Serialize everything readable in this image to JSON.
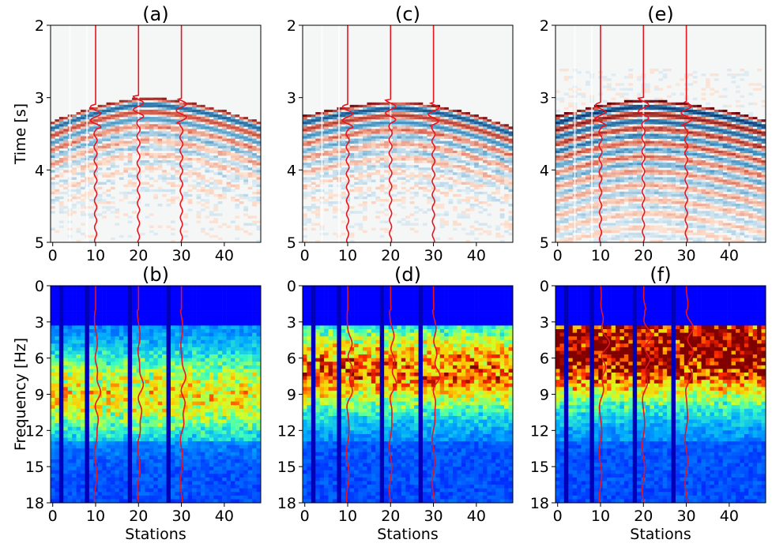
{
  "figure": {
    "ylabel_top": "Time [s]",
    "ylabel_bottom": "Frequency [Hz]",
    "xlabel": "Stations"
  },
  "colors": {
    "trace": "#e8141e",
    "seismic_negative": "#08306b",
    "seismic_positive": "#67000d",
    "background": "#f5f6f6"
  },
  "chart_data": [
    {
      "type": "heatmap",
      "title": "(a)",
      "row": "top",
      "colormap": "RdBu",
      "xlabel": "",
      "ylabel": "Time [s]",
      "xlim": [
        -0.5,
        48.5
      ],
      "ylim": [
        5,
        2
      ],
      "xticks": [
        0,
        10,
        20,
        30,
        40
      ],
      "yticks": [
        2,
        3,
        4,
        5
      ],
      "arrival_apex_station": 22,
      "arrival_apex_time": 3.05,
      "arrival_edge_time_left": 3.38,
      "arrival_edge_time_right": 3.38,
      "traces_at_stations": [
        10,
        20,
        30
      ]
    },
    {
      "type": "heatmap",
      "title": "(c)",
      "row": "top",
      "colormap": "RdBu",
      "xlabel": "",
      "ylabel": "",
      "xlim": [
        -0.5,
        48.5
      ],
      "ylim": [
        5,
        2
      ],
      "xticks": [
        0,
        10,
        20,
        30,
        40
      ],
      "yticks": [
        2,
        3,
        4,
        5
      ],
      "arrival_apex_station": 22,
      "arrival_apex_time": 3.1,
      "arrival_edge_time_left": 3.3,
      "arrival_edge_time_right": 3.45,
      "traces_at_stations": [
        10,
        20,
        30
      ]
    },
    {
      "type": "heatmap",
      "title": "(e)",
      "row": "top",
      "colormap": "RdBu",
      "xlabel": "",
      "ylabel": "",
      "xlim": [
        -0.5,
        48.5
      ],
      "ylim": [
        5,
        2
      ],
      "xticks": [
        0,
        10,
        20,
        30,
        40
      ],
      "yticks": [
        2,
        3,
        4,
        5
      ],
      "arrival_apex_station": 20,
      "arrival_apex_time": 3.08,
      "arrival_edge_time_left": 3.3,
      "arrival_edge_time_right": 3.35,
      "traces_at_stations": [
        10,
        20,
        30
      ]
    },
    {
      "type": "heatmap",
      "title": "(b)",
      "row": "bottom",
      "colormap": "jet",
      "xlabel": "Stations",
      "ylabel": "Frequency [Hz]",
      "xlim": [
        -0.5,
        48.5
      ],
      "ylim": [
        18,
        0
      ],
      "xticks": [
        0,
        10,
        20,
        30,
        40
      ],
      "yticks": [
        0,
        3,
        6,
        9,
        12,
        15,
        18
      ],
      "energy_band_hz": [
        7,
        11
      ],
      "band_strength": 0.45,
      "traces_at_stations": [
        10,
        20,
        30
      ]
    },
    {
      "type": "heatmap",
      "title": "(d)",
      "row": "bottom",
      "colormap": "jet",
      "xlabel": "Stations",
      "ylabel": "",
      "xlim": [
        -0.5,
        48.5
      ],
      "ylim": [
        18,
        0
      ],
      "xticks": [
        0,
        10,
        20,
        30,
        40
      ],
      "yticks": [
        0,
        3,
        6,
        9,
        12,
        15,
        18
      ],
      "energy_band_hz": [
        5,
        9
      ],
      "band_strength": 0.6,
      "traces_at_stations": [
        10,
        20,
        30
      ]
    },
    {
      "type": "heatmap",
      "title": "(f)",
      "row": "bottom",
      "colormap": "jet",
      "xlabel": "Stations",
      "ylabel": "",
      "xlim": [
        -0.5,
        48.5
      ],
      "ylim": [
        18,
        0
      ],
      "xticks": [
        0,
        10,
        20,
        30,
        40
      ],
      "yticks": [
        0,
        3,
        6,
        9,
        12,
        15,
        18
      ],
      "energy_band_hz": [
        2.5,
        8
      ],
      "band_strength": 0.85,
      "traces_at_stations": [
        10,
        20,
        30
      ]
    }
  ]
}
